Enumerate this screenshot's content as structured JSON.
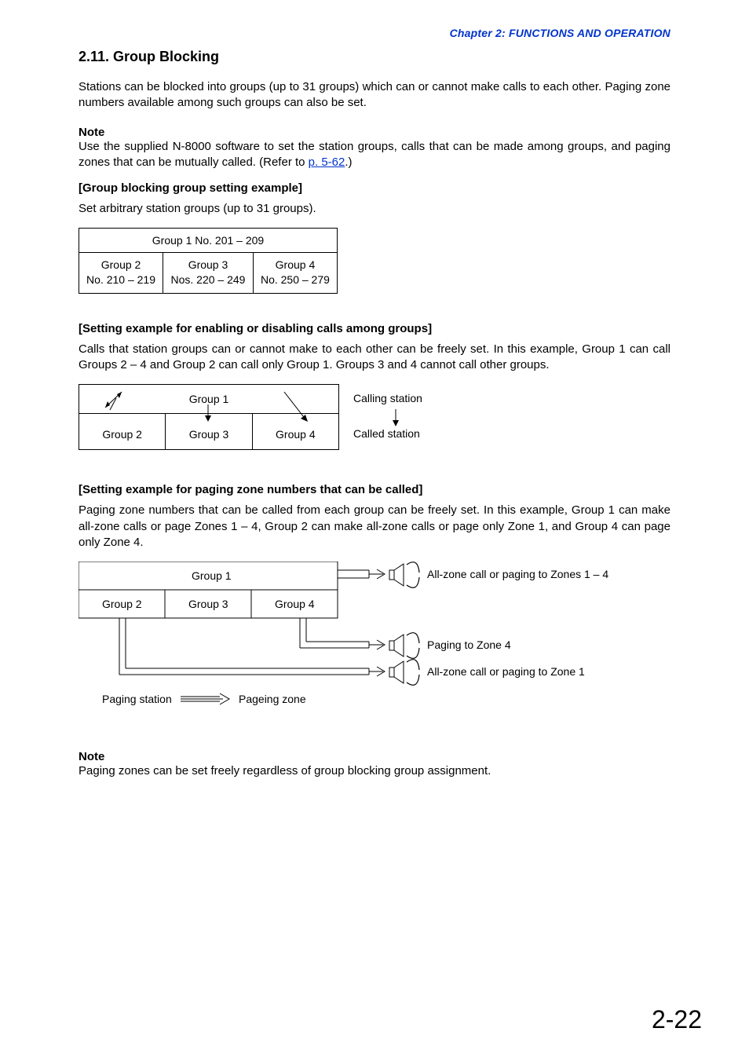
{
  "chapter_header": "Chapter 2:  FUNCTIONS AND OPERATION",
  "section_title": "2.11. Group Blocking",
  "intro_para": "Stations can be blocked into groups (up to 31 groups) which can or cannot make calls to each other. Paging zone numbers available among such groups can also be set.",
  "note1": {
    "title": "Note",
    "body_pre": "Use the supplied N-8000 software to set the station groups, calls that can be made among groups, and paging zones that can be mutually called. (Refer to ",
    "link": "p. 5-62",
    "body_post": ".)"
  },
  "sub1": {
    "header": "[Group blocking group setting example]",
    "text": "Set arbitrary station groups (up to 31 groups).",
    "table": {
      "top": "Group 1   No. 201 – 209",
      "cells": [
        {
          "title": "Group 2",
          "sub": "No. 210 – 219"
        },
        {
          "title": "Group 3",
          "sub": "Nos. 220 – 249"
        },
        {
          "title": "Group 4",
          "sub": "No. 250 – 279"
        }
      ]
    }
  },
  "sub2": {
    "header": "[Setting example for enabling or disabling calls among groups]",
    "text": "Calls that station groups can or cannot make to each other can be freely set. In this example, Group 1 can call Groups 2 – 4 and Group 2 can call only Group 1. Groups 3 and 4 cannot call other groups.",
    "diagram": {
      "top": "Group 1",
      "cells": [
        "Group 2",
        "Group 3",
        "Group 4"
      ],
      "side1": "Calling station",
      "side2": "Called station"
    }
  },
  "sub3": {
    "header": "[Setting example for paging zone numbers that can be called]",
    "text": "Paging zone numbers that can be called from each group can be freely set. In this example, Group 1 can make all-zone calls or page Zones 1 – 4, Group 2 can make all-zone calls or page only Zone 1, and Group 4 can page only Zone 4.",
    "diagram": {
      "top": "Group 1",
      "cells": [
        "Group 2",
        "Group 3",
        "Group 4"
      ],
      "speaker1": "All-zone call or paging to Zones 1 – 4",
      "speaker2": "Paging to Zone 4",
      "speaker3": "All-zone call or paging to Zone 1",
      "legend_left": "Paging station",
      "legend_right": "Pageing zone"
    }
  },
  "note2": {
    "title": "Note",
    "body": "Paging zones can be set freely regardless of group blocking group assignment."
  },
  "page_number": "2-22"
}
